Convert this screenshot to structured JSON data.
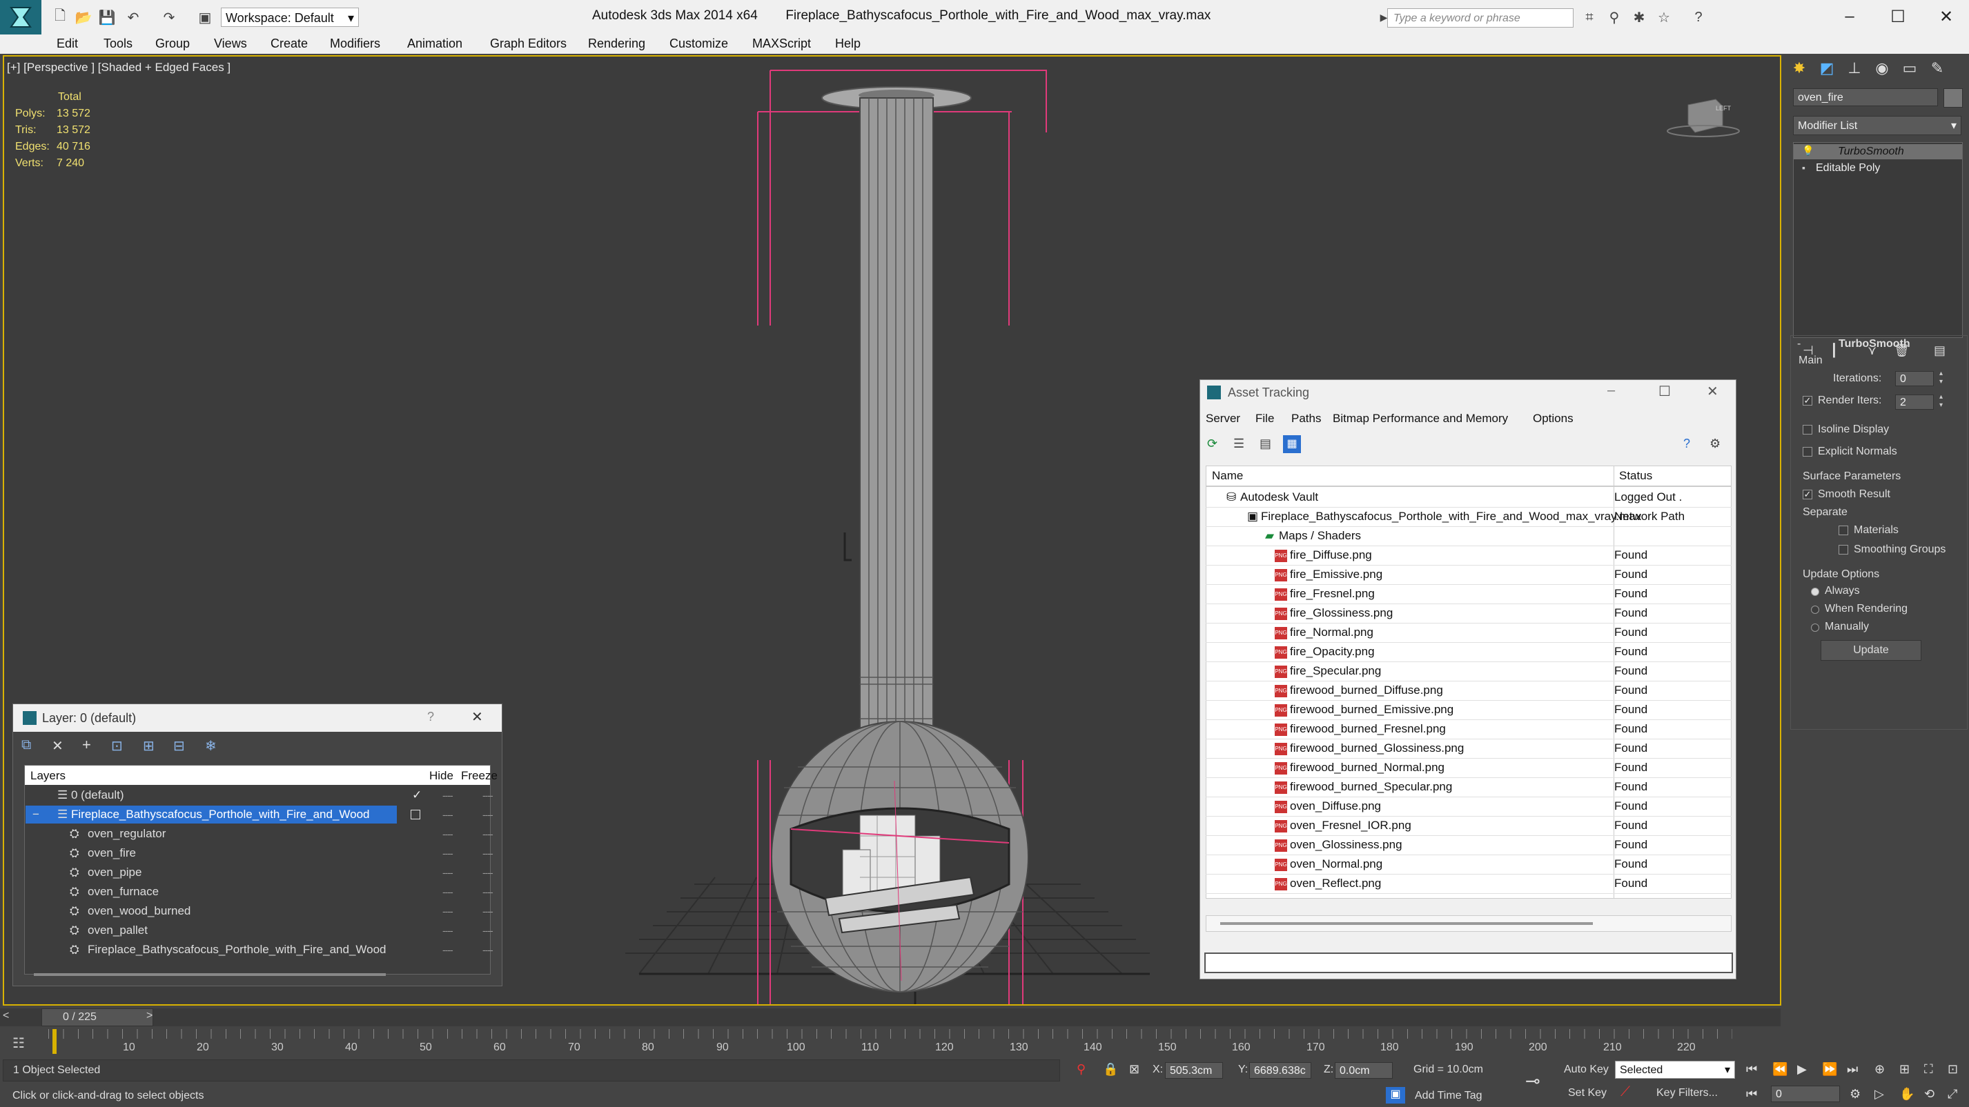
{
  "titlebar": {
    "app_name": "Autodesk 3ds Max  2014 x64",
    "file_name": "Fireplace_Bathyscafocus_Porthole_with_Fire_and_Wood_max_vray.max",
    "workspace": "Workspace: Default",
    "search_placeholder": "Type a keyword or phrase"
  },
  "menu": [
    "Edit",
    "Tools",
    "Group",
    "Views",
    "Create",
    "Modifiers",
    "Animation",
    "Graph Editors",
    "Rendering",
    "Customize",
    "MAXScript",
    "Help"
  ],
  "viewport": {
    "label": "[+] [Perspective ] [Shaded + Edged Faces ]",
    "stats": {
      "header": "Total",
      "rows": [
        {
          "label": "Polys:",
          "value": "13 572"
        },
        {
          "label": "Tris:",
          "value": "13 572"
        },
        {
          "label": "Edges:",
          "value": "40 716"
        },
        {
          "label": "Verts:",
          "value": "7 240"
        }
      ]
    },
    "viewcube_label": "LEFT"
  },
  "command_panel": {
    "object_name": "oven_fire",
    "modifier_list": "Modifier List",
    "stack": [
      "TurboSmooth",
      "Editable Poly"
    ],
    "rollout_title": "TurboSmooth",
    "main_group": "Main",
    "iterations_label": "Iterations:",
    "iterations_value": "0",
    "render_iters_label": "Render Iters:",
    "render_iters_value": "2",
    "isoline_display": "Isoline Display",
    "explicit_normals": "Explicit Normals",
    "surface_group": "Surface Parameters",
    "smooth_result": "Smooth Result",
    "separate": "Separate",
    "materials": "Materials",
    "smoothing_groups": "Smoothing Groups",
    "update_group": "Update Options",
    "always": "Always",
    "when_rendering": "When Rendering",
    "manually": "Manually",
    "update_button": "Update"
  },
  "asset_tracking": {
    "title": "Asset Tracking",
    "menu": [
      "Server",
      "File",
      "Paths",
      "Bitmap Performance and Memory",
      "Options"
    ],
    "col_name": "Name",
    "col_status": "Status",
    "rows": [
      {
        "name": "Autodesk Vault",
        "status": "Logged Out ."
      },
      {
        "name": "Fireplace_Bathyscafocus_Porthole_with_Fire_and_Wood_max_vray.max",
        "status": "Network Path"
      },
      {
        "name": "Maps / Shaders",
        "status": ""
      },
      {
        "name": "fire_Diffuse.png",
        "status": "Found"
      },
      {
        "name": "fire_Emissive.png",
        "status": "Found"
      },
      {
        "name": "fire_Fresnel.png",
        "status": "Found"
      },
      {
        "name": "fire_Glossiness.png",
        "status": "Found"
      },
      {
        "name": "fire_Normal.png",
        "status": "Found"
      },
      {
        "name": "fire_Opacity.png",
        "status": "Found"
      },
      {
        "name": "fire_Specular.png",
        "status": "Found"
      },
      {
        "name": "firewood_burned_Diffuse.png",
        "status": "Found"
      },
      {
        "name": "firewood_burned_Emissive.png",
        "status": "Found"
      },
      {
        "name": "firewood_burned_Fresnel.png",
        "status": "Found"
      },
      {
        "name": "firewood_burned_Glossiness.png",
        "status": "Found"
      },
      {
        "name": "firewood_burned_Normal.png",
        "status": "Found"
      },
      {
        "name": "firewood_burned_Specular.png",
        "status": "Found"
      },
      {
        "name": "oven_Diffuse.png",
        "status": "Found"
      },
      {
        "name": "oven_Fresnel_IOR.png",
        "status": "Found"
      },
      {
        "name": "oven_Glossiness.png",
        "status": "Found"
      },
      {
        "name": "oven_Normal.png",
        "status": "Found"
      },
      {
        "name": "oven_Reflect.png",
        "status": "Found"
      }
    ]
  },
  "layers_panel": {
    "title": "Layer: 0 (default)",
    "help": "?",
    "col_layers": "Layers",
    "col_hide": "Hide",
    "col_freeze": "Freeze",
    "rows": [
      {
        "name": "0 (default)"
      },
      {
        "name": "Fireplace_Bathyscafocus_Porthole_with_Fire_and_Wood"
      },
      {
        "name": "oven_regulator"
      },
      {
        "name": "oven_fire"
      },
      {
        "name": "oven_pipe"
      },
      {
        "name": "oven_furnace"
      },
      {
        "name": "oven_wood_burned"
      },
      {
        "name": "oven_pallet"
      },
      {
        "name": "Fireplace_Bathyscafocus_Porthole_with_Fire_and_Wood"
      }
    ]
  },
  "timeline": {
    "frame_counter": "0 / 225",
    "ticks": [
      "10",
      "20",
      "30",
      "40",
      "50",
      "60",
      "70",
      "80",
      "90",
      "100",
      "110",
      "120",
      "130",
      "140",
      "150",
      "160",
      "170",
      "180",
      "190",
      "200",
      "210",
      "220"
    ]
  },
  "status": {
    "selection": "1 Object Selected",
    "prompt": "Click or click-and-drag to select objects",
    "x_label": "X:",
    "x_value": "505.3cm",
    "y_label": "Y:",
    "y_value": "6689.638c",
    "z_label": "Z:",
    "z_value": "0.0cm",
    "grid": "Grid = 10.0cm",
    "auto_key": "Auto Key",
    "set_key": "Set Key",
    "selected_dropdown": "Selected",
    "key_filters": "Key Filters...",
    "add_time_tag": "Add Time Tag",
    "frame_value": "0"
  }
}
